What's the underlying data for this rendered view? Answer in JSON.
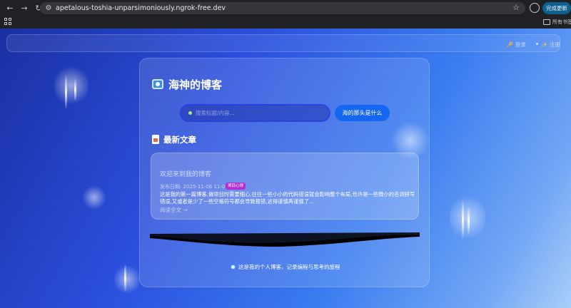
{
  "browser": {
    "url": "apetalous-toshia-unparsimoniously.ngrok-free.dev",
    "update_button": "完成更新",
    "all_bookmarks": "所有书签"
  },
  "nav": {
    "login": "🔑 登录",
    "register": "✨ 注册"
  },
  "site": {
    "title": "海神的博客"
  },
  "search": {
    "placeholder": "搜索标题/内容...",
    "button_label": "海的那头是什么"
  },
  "section": {
    "title": "最新文章"
  },
  "post": {
    "title": "欢迎来到我的博客",
    "date": "发布日期: 2025-11-06 11:03",
    "tag": "项目心得",
    "excerpt": "这是我的第一篇博客,做项目时需要细心,往往一些小小的代码错误就会影响整个布局,也许是一些微小的名词拼写错误,又或者是少了一些空格符号都会导致报错,这得谨慎再谨慎了...",
    "read_more": "阅读全文 →"
  },
  "footer": {
    "text": "这是我的个人博客，记录编程与思考的旅程"
  },
  "colors": {
    "accent": "#1566f0",
    "tag": "#b32fd0",
    "search_border": "#2a3ff0"
  }
}
